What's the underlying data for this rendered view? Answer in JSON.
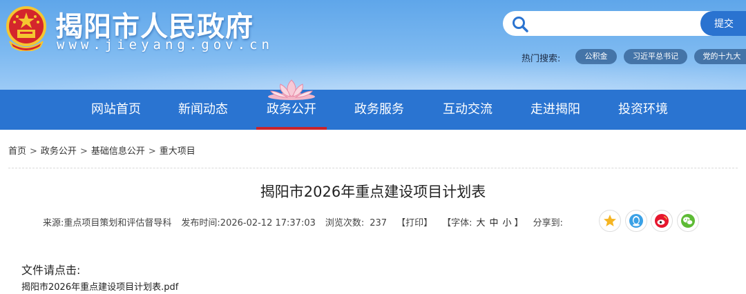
{
  "header": {
    "site_title": "揭阳市人民政府",
    "site_url": "www.jieyang.gov.cn",
    "search": {
      "placeholder": "",
      "submit_label": "提交"
    },
    "hot_search": {
      "label": "热门搜索:",
      "tags": [
        "公积金",
        "习近平总书记",
        "党的十九大"
      ]
    }
  },
  "nav": {
    "items": [
      "网站首页",
      "新闻动态",
      "政务公开",
      "政务服务",
      "互动交流",
      "走进揭阳",
      "投资环境"
    ],
    "active": "政务公开"
  },
  "breadcrumb": [
    "首页",
    "政务公开",
    "基础信息公开",
    "重大项目"
  ],
  "breadcrumb_separator": ">",
  "article": {
    "title": "揭阳市2026年重点建设项目计划表",
    "meta": {
      "source_label": "来源:",
      "source": "重点项目策划和评估督导科",
      "time_label": "发布时间:",
      "time": "2026-02-12 17:37:03",
      "views_label": "浏览次数:",
      "views": "237",
      "print": "【打印】",
      "font_label": "【字体:",
      "font_large": "大",
      "font_medium": "中",
      "font_small": "小",
      "font_close": "】",
      "share_label": "分享到:"
    },
    "files_label": "文件请点击:",
    "file_name": "揭阳市2026年重点建设项目计划表.pdf"
  },
  "colors": {
    "header_bg": "#6aaeee",
    "nav_bg": "#2a74d1",
    "active_underline": "#c9232b",
    "search_button": "#2a73d0",
    "hot_tag_bg": "#4474a8"
  },
  "icons": [
    "national-emblem-icon",
    "search-icon",
    "lotus-icon",
    "qzone-star-icon",
    "qq-icon",
    "weibo-icon",
    "wechat-icon"
  ]
}
